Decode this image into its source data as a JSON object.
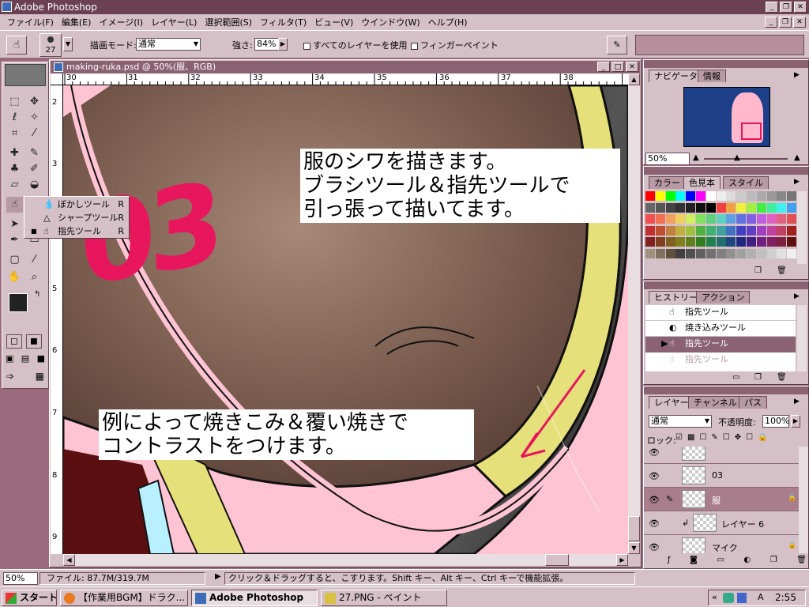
{
  "app": {
    "title": "Adobe Photoshop"
  },
  "menu": [
    "ファイル(F)",
    "編集(E)",
    "イメージ(I)",
    "レイヤー(L)",
    "選択範囲(S)",
    "フィルタ(T)",
    "ビュー(V)",
    "ウインドウ(W)",
    "ヘルプ(H)"
  ],
  "options": {
    "brush_size": "27",
    "mode_label": "描画モード:",
    "mode_value": "通常",
    "strength_label": "強さ:",
    "strength_value": "84%",
    "all_layers_label": "すべてのレイヤーを使用",
    "finger_paint_label": "フィンガーペイント"
  },
  "document": {
    "title": "making-ruka.psd @ 50%(服、RGB)",
    "ruler_top": [
      "30",
      "31",
      "32",
      "33",
      "34",
      "35",
      "36",
      "37",
      "38"
    ],
    "ruler_left": [
      "2",
      "3",
      "4",
      "5",
      "6",
      "7",
      "8",
      "9"
    ]
  },
  "flyout": {
    "items": [
      {
        "label": "ぼかしツール",
        "key": "R"
      },
      {
        "label": "シャープツール",
        "key": "R"
      },
      {
        "label": "指先ツール",
        "key": "R"
      }
    ]
  },
  "canvas": {
    "number_text": "03",
    "annotation1": [
      "服のシワを描きます。",
      "ブラシツール＆指先ツールで",
      "引っ張って描いてます。"
    ],
    "annotation2": [
      "例によって焼きこみ＆覆い焼きで",
      "コントラストをつけます。"
    ]
  },
  "navigator": {
    "tabs": [
      "ナビゲータ",
      "情報"
    ],
    "zoom": "50%"
  },
  "swatches": {
    "tabs": [
      "カラー",
      "色見本",
      "スタイル"
    ]
  },
  "history": {
    "tabs": [
      "ヒストリー",
      "アクション"
    ],
    "items": [
      "指先ツール",
      "焼き込みツール",
      "指先ツール",
      "指先ツール"
    ]
  },
  "layers": {
    "tabs": [
      "レイヤー",
      "チャンネル",
      "パス"
    ],
    "blend_mode": "通常",
    "opacity_label": "不透明度:",
    "opacity_value": "100%",
    "lock_label": "ロック:",
    "rows": [
      {
        "name": "03"
      },
      {
        "name": "服"
      },
      {
        "name": "レイヤー 6"
      },
      {
        "name": "マイク"
      }
    ]
  },
  "status": {
    "zoom": "50%",
    "file_info": "ファイル: 87.7M/319.7M",
    "hint": "クリック＆ドラッグすると、こすります。Shift キー、Alt キー、Ctrl キーで機能拡張。"
  },
  "taskbar": {
    "start": "スタート",
    "tasks": [
      "【作業用BGM】ドラク...",
      "Adobe Photoshop",
      "27.PNG - ペイント"
    ],
    "time": "2:55"
  },
  "colors": {
    "accent": "#e8175d",
    "ui_face": "#d4c0c6",
    "title_bar": "#6b4151"
  }
}
